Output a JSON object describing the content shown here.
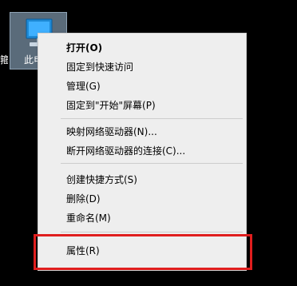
{
  "desktop": {
    "icon_name": "this-pc-icon",
    "label": "此电",
    "left_label": "箍"
  },
  "menu": {
    "items": [
      {
        "label": "打开(O)",
        "bold": true
      },
      {
        "label": "固定到快速访问"
      },
      {
        "label": "管理(G)"
      },
      {
        "label": "固定到\"开始\"屏幕(P)"
      },
      {
        "label": "映射网络驱动器(N)..."
      },
      {
        "label": "断开网络驱动器的连接(C)..."
      },
      {
        "label": "创建快捷方式(S)"
      },
      {
        "label": "删除(D)"
      },
      {
        "label": "重命名(M)"
      },
      {
        "label": "属性(R)"
      }
    ]
  },
  "colors": {
    "desktop_bg": "#000000",
    "menu_bg": "#eeeeee",
    "highlight_border": "#e01e1e"
  }
}
